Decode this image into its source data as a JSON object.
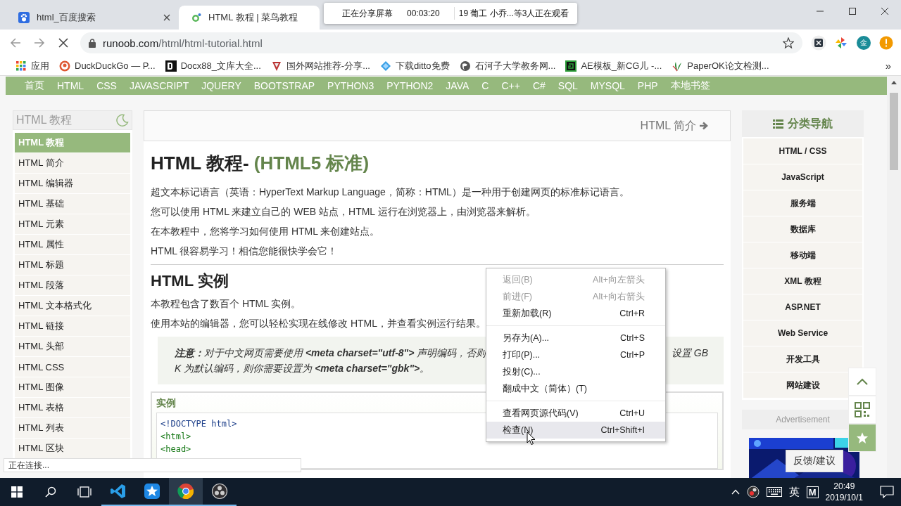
{
  "browser": {
    "tabs": [
      {
        "title": "html_百度搜索",
        "selected": false
      },
      {
        "title": "HTML 教程 | 菜鸟教程",
        "selected": true
      }
    ],
    "address": {
      "domain": "runoob.com",
      "path": "/html/html-tutorial.html"
    },
    "avatar": "金",
    "bookmarks": [
      {
        "label": "应用"
      },
      {
        "label": "DuckDuckGo — P..."
      },
      {
        "label": "Docx88_文库大全..."
      },
      {
        "label": "国外网站推荐-分享..."
      },
      {
        "label": "下载ditto免费"
      },
      {
        "label": "石河子大学教务网..."
      },
      {
        "label": "AE模板_新CG儿 -..."
      },
      {
        "label": "PaperOK论文检测..."
      }
    ],
    "bookmarks_more": "»"
  },
  "share_banner": {
    "status": "正在分享屏幕",
    "timer": "00:03:20",
    "viewers": "19 葡工 小乔...等3人正在观看"
  },
  "site": {
    "nav": [
      "首页",
      "HTML",
      "CSS",
      "JAVASCRIPT",
      "JQUERY",
      "BOOTSTRAP",
      "PYTHON3",
      "PYTHON2",
      "JAVA",
      "C",
      "C++",
      "C#",
      "SQL",
      "MYSQL",
      "PHP",
      "本地书签"
    ],
    "sidebar": {
      "title": "HTML 教程",
      "items": [
        {
          "label": "HTML 教程",
          "selected": true
        },
        {
          "label": "HTML 简介",
          "selected": false
        },
        {
          "label": "HTML 编辑器",
          "selected": false
        },
        {
          "label": "HTML 基础",
          "selected": false
        },
        {
          "label": "HTML 元素",
          "selected": false
        },
        {
          "label": "HTML 属性",
          "selected": false
        },
        {
          "label": "HTML 标题",
          "selected": false
        },
        {
          "label": "HTML 段落",
          "selected": false
        },
        {
          "label": "HTML 文本格式化",
          "selected": false
        },
        {
          "label": "HTML 链接",
          "selected": false
        },
        {
          "label": "HTML 头部",
          "selected": false
        },
        {
          "label": "HTML CSS",
          "selected": false
        },
        {
          "label": "HTML 图像",
          "selected": false
        },
        {
          "label": "HTML 表格",
          "selected": false
        },
        {
          "label": "HTML 列表",
          "selected": false
        },
        {
          "label": "HTML 区块",
          "selected": false
        }
      ]
    },
    "article": {
      "next_link": "HTML 简介",
      "title": "HTML 教程- ",
      "title_accent": "(HTML5 标准)",
      "intro": [
        "超文本标记语言（英语：HyperText Markup Language，简称：HTML）是一种用于创建网页的标准标记语言。",
        "您可以使用 HTML 来建立自己的 WEB 站点，HTML 运行在浏览器上，由浏览器来解析。",
        "在本教程中，您将学习如何使用 HTML 来创建站点。",
        "HTML 很容易学习！相信您能很快学会它！"
      ],
      "section_title": "HTML 实例",
      "section_text": [
        "本教程包含了数百个 HTML 实例。",
        "使用本站的编辑器，您可以轻松实现在线修改 HTML，并查看实例运行结果。"
      ],
      "note": {
        "line1_start": "**注意：**对于中文网页需要使用 **<meta charset=\"utf-8\">** 声明编码，否则",
        "line1_end": "设置 GB",
        "line2": "K 为默认编码，则你需要设置为 **<meta charset=\"gbk\">**。"
      },
      "example": {
        "title": "实例",
        "code": [
          {
            "text": "<!DOCTYPE html>",
            "kind": "doctype"
          },
          {
            "text": "<html>",
            "kind": "tag"
          },
          {
            "text": "<head>",
            "kind": "tag"
          }
        ]
      }
    },
    "category_nav": {
      "title": "分类导航",
      "items": [
        "HTML / CSS",
        "JavaScript",
        "服务端",
        "数据库",
        "移动端",
        "XML 教程",
        "ASP.NET",
        "Web Service",
        "开发工具",
        "网站建设"
      ]
    },
    "advertisement": {
      "label": "Advertisement",
      "kind": "picture"
    }
  },
  "context_menu": {
    "groups": [
      [
        {
          "label": "返回(B)",
          "shortcut": "Alt+向左箭头",
          "disabled": true,
          "selected": false
        },
        {
          "label": "前进(F)",
          "shortcut": "Alt+向右箭头",
          "disabled": true,
          "selected": false
        },
        {
          "label": "重新加载(R)",
          "shortcut": "Ctrl+R",
          "disabled": false,
          "selected": false
        }
      ],
      [
        {
          "label": "另存为(A)...",
          "shortcut": "Ctrl+S",
          "disabled": false,
          "selected": false
        },
        {
          "label": "打印(P)...",
          "shortcut": "Ctrl+P",
          "disabled": false,
          "selected": false
        },
        {
          "label": "投射(C)...",
          "disabled": false,
          "selected": false
        },
        {
          "label": "翻成中文（简体）(T)",
          "disabled": false,
          "selected": false
        }
      ],
      [
        {
          "label": "查看网页源代码(V)",
          "shortcut": "Ctrl+U",
          "disabled": false,
          "selected": false
        },
        {
          "label": "检查(N)",
          "shortcut": "Ctrl+Shift+I",
          "disabled": false,
          "selected": true
        }
      ]
    ]
  },
  "feedback": "反馈/建议",
  "status_text": "正在连接...",
  "taskbar": {
    "apps": [
      {
        "kind": "vscode",
        "selected": false
      },
      {
        "kind": "star",
        "selected": false
      },
      {
        "kind": "chrome",
        "selected": true
      },
      {
        "kind": "obs",
        "selected": false
      }
    ],
    "ime": "英",
    "ime_mode": "M",
    "time": "20:49",
    "date": "2019/10/1"
  }
}
